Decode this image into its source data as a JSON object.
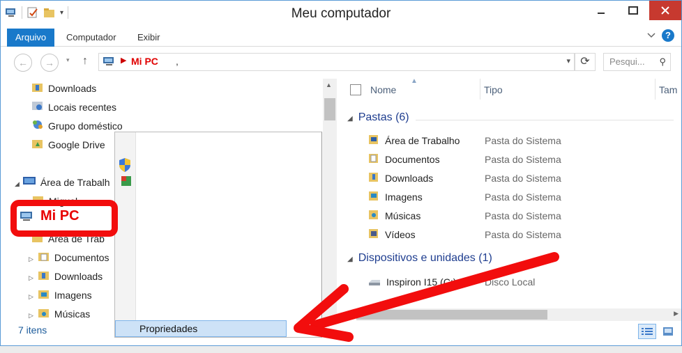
{
  "window": {
    "title": "Meu computador"
  },
  "ribbon": {
    "file_tab": "Arquivo",
    "tabs": [
      "Computador",
      "Exibir"
    ]
  },
  "address": {
    "crumb": "Mi PC",
    "tick": ","
  },
  "search": {
    "placeholder": "Pesqui..."
  },
  "nav": {
    "items": [
      {
        "label": "Downloads",
        "icon": "downloads-folder-icon"
      },
      {
        "label": "Locais recentes",
        "icon": "recent-places-icon"
      },
      {
        "label": "Grupo doméstico",
        "icon": "homegroup-icon"
      },
      {
        "label": "Google Drive",
        "icon": "google-drive-folder-icon"
      },
      {
        "label": "Área de Trabalh",
        "icon": "desktop-icon"
      },
      {
        "label": "Miguel",
        "icon": "user-folder-icon"
      },
      {
        "label": "Mi PC",
        "icon": "computer-icon"
      },
      {
        "label": "Área de Trab",
        "icon": "desktop-folder-icon"
      },
      {
        "label": "Documentos",
        "icon": "documents-folder-icon"
      },
      {
        "label": "Downloads",
        "icon": "downloads-folder-icon"
      },
      {
        "label": "Imagens",
        "icon": "pictures-folder-icon"
      },
      {
        "label": "Músicas",
        "icon": "music-folder-icon"
      }
    ]
  },
  "status": {
    "count": "7 itens"
  },
  "context_menu": {
    "properties": "Propriedades"
  },
  "columns": {
    "name": "Nome",
    "type": "Tipo",
    "size": "Tam"
  },
  "groups": {
    "folders": {
      "title": "Pastas (6)",
      "rows": [
        {
          "name": "Área de Trabalho",
          "type": "Pasta do Sistema"
        },
        {
          "name": "Documentos",
          "type": "Pasta do Sistema"
        },
        {
          "name": "Downloads",
          "type": "Pasta do Sistema"
        },
        {
          "name": "Imagens",
          "type": "Pasta do Sistema"
        },
        {
          "name": "Músicas",
          "type": "Pasta do Sistema"
        },
        {
          "name": "Vídeos",
          "type": "Pasta do Sistema"
        }
      ]
    },
    "devices": {
      "title": "Dispositivos e unidades (1)",
      "rows": [
        {
          "name": "Inspiron I15 (C:)",
          "type": "Disco Local"
        }
      ]
    }
  },
  "colors": {
    "accent": "#1979ca",
    "annotation": "#f20d0d",
    "group_title": "#1e3d8f"
  }
}
